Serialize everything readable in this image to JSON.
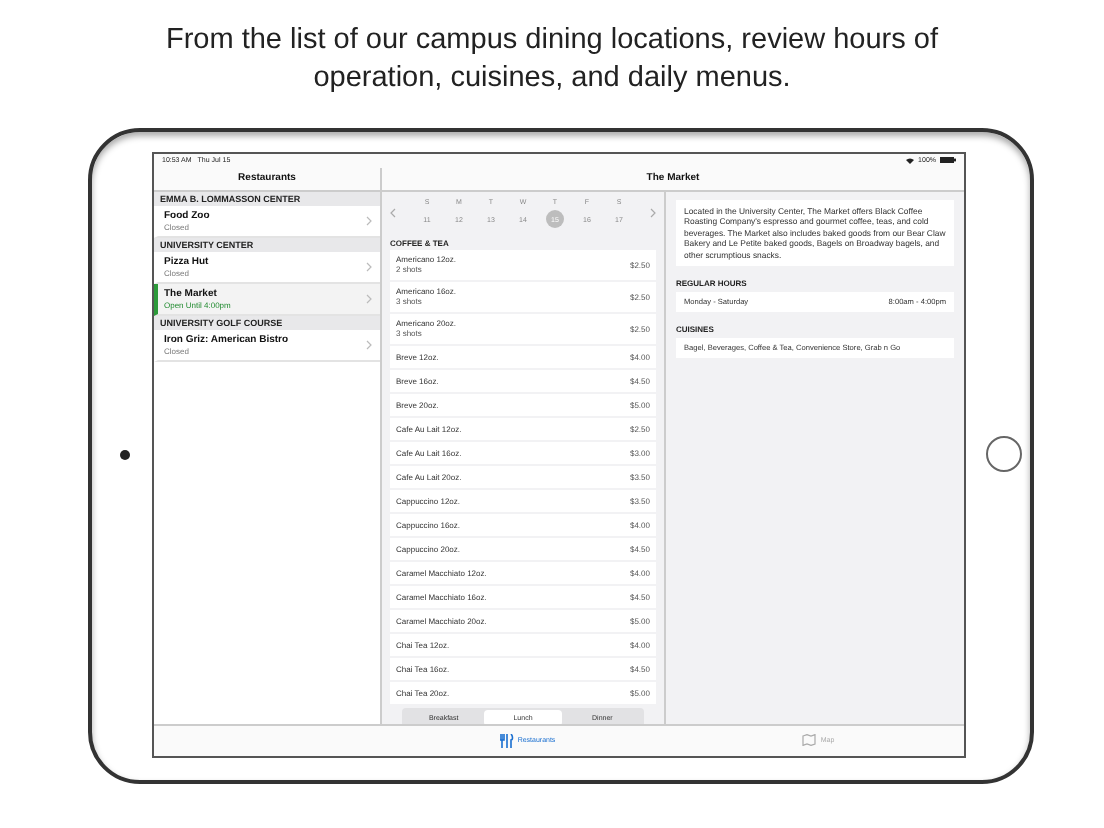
{
  "headline": "From the list of our campus dining locations, review hours of operation, cuisines, and daily menus.",
  "status_bar": {
    "time": "10:53 AM",
    "date": "Thu Jul 15",
    "battery": "100%"
  },
  "sidebar": {
    "title": "Restaurants",
    "sections": [
      {
        "title": "EMMA B. LOMMASSON CENTER",
        "items": [
          {
            "name": "Food Zoo",
            "status": "Closed",
            "open": false,
            "selected": false
          }
        ]
      },
      {
        "title": "UNIVERSITY CENTER",
        "items": [
          {
            "name": "Pizza Hut",
            "status": "Closed",
            "open": false,
            "selected": false
          },
          {
            "name": "The Market",
            "status": "Open Until 4:00pm",
            "open": true,
            "selected": true
          }
        ]
      },
      {
        "title": "UNIVERSITY GOLF COURSE",
        "items": [
          {
            "name": "Iron Griz: American Bistro",
            "status": "Closed",
            "open": false,
            "selected": false
          }
        ]
      }
    ]
  },
  "detail_title": "The Market",
  "week": {
    "days": [
      "S",
      "M",
      "T",
      "W",
      "T",
      "F",
      "S"
    ],
    "dates": [
      {
        "label": "11",
        "selected": false
      },
      {
        "label": "12",
        "selected": false
      },
      {
        "label": "13",
        "selected": false
      },
      {
        "label": "14",
        "selected": false
      },
      {
        "label": "15",
        "selected": true
      },
      {
        "label": "16",
        "selected": false
      },
      {
        "label": "17",
        "selected": false
      }
    ]
  },
  "menu": {
    "section": "COFFEE & TEA",
    "items": [
      {
        "name": "Americano 12oz.",
        "note": "2 shots",
        "price": "$2.50"
      },
      {
        "name": "Americano 16oz.",
        "note": "3 shots",
        "price": "$2.50"
      },
      {
        "name": "Americano 20oz.",
        "note": "3 shots",
        "price": "$2.50"
      },
      {
        "name": "Breve 12oz.",
        "price": "$4.00"
      },
      {
        "name": "Breve 16oz.",
        "price": "$4.50"
      },
      {
        "name": "Breve 20oz.",
        "price": "$5.00"
      },
      {
        "name": "Cafe Au Lait 12oz.",
        "price": "$2.50"
      },
      {
        "name": "Cafe Au Lait 16oz.",
        "price": "$3.00"
      },
      {
        "name": "Cafe Au Lait 20oz.",
        "price": "$3.50"
      },
      {
        "name": "Cappuccino 12oz.",
        "price": "$3.50"
      },
      {
        "name": "Cappuccino 16oz.",
        "price": "$4.00"
      },
      {
        "name": "Cappuccino 20oz.",
        "price": "$4.50"
      },
      {
        "name": "Caramel Macchiato 12oz.",
        "price": "$4.00"
      },
      {
        "name": "Caramel Macchiato 16oz.",
        "price": "$4.50"
      },
      {
        "name": "Caramel Macchiato 20oz.",
        "price": "$5.00"
      },
      {
        "name": "Chai Tea 12oz.",
        "price": "$4.00"
      },
      {
        "name": "Chai Tea 16oz.",
        "price": "$4.50"
      },
      {
        "name": "Chai Tea 20oz.",
        "price": "$5.00"
      }
    ]
  },
  "meals": [
    {
      "label": "Breakfast",
      "selected": false
    },
    {
      "label": "Lunch",
      "selected": true
    },
    {
      "label": "Dinner",
      "selected": false
    }
  ],
  "info": {
    "description": "Located in the University Center, The Market offers Black Coffee Roasting Company's espresso and gourmet coffee, teas, and cold beverages. The Market also includes baked goods from our Bear Claw Bakery and Le Petite baked goods, Bagels on Broadway bagels, and other scrumptious snacks.",
    "hours_title": "REGULAR HOURS",
    "hours": [
      {
        "days": "Monday - Saturday",
        "time": "8:00am - 4:00pm"
      }
    ],
    "cuisines_title": "CUISINES",
    "cuisines": "Bagel, Beverages, Coffee & Tea, Convenience Store, Grab n Go"
  },
  "tab_bar": [
    {
      "label": "Restaurants",
      "kind": "fork",
      "selected": true
    },
    {
      "label": "Map",
      "kind": "map",
      "selected": false
    }
  ]
}
